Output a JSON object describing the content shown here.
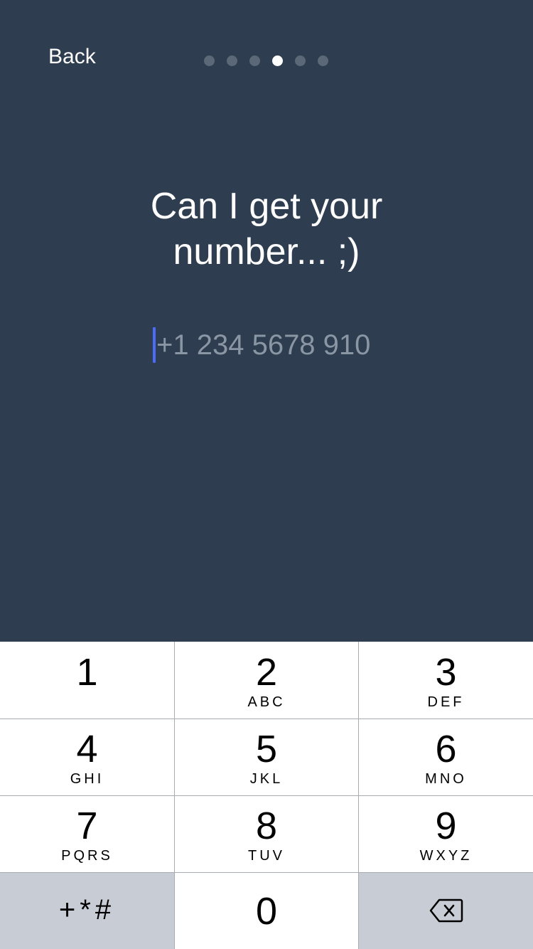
{
  "nav": {
    "back_label": "Back",
    "progress": {
      "total": 6,
      "current": 4
    }
  },
  "main": {
    "title_line1": "Can I get your",
    "title_line2": "number... ;)",
    "phone_placeholder": "+1 234 5678 910",
    "phone_value": ""
  },
  "keypad": {
    "keys": [
      {
        "num": "1",
        "letters": ""
      },
      {
        "num": "2",
        "letters": "ABC"
      },
      {
        "num": "3",
        "letters": "DEF"
      },
      {
        "num": "4",
        "letters": "GHI"
      },
      {
        "num": "5",
        "letters": "JKL"
      },
      {
        "num": "6",
        "letters": "MNO"
      },
      {
        "num": "7",
        "letters": "PQRS"
      },
      {
        "num": "8",
        "letters": "TUV"
      },
      {
        "num": "9",
        "letters": "WXYZ"
      }
    ],
    "symbols_label": "+*#",
    "zero_label": "0",
    "delete_icon": "backspace-icon"
  },
  "colors": {
    "background": "#2e3d4f",
    "caret": "#4a6cf7",
    "keypad_gray": "#c8ccd4"
  }
}
